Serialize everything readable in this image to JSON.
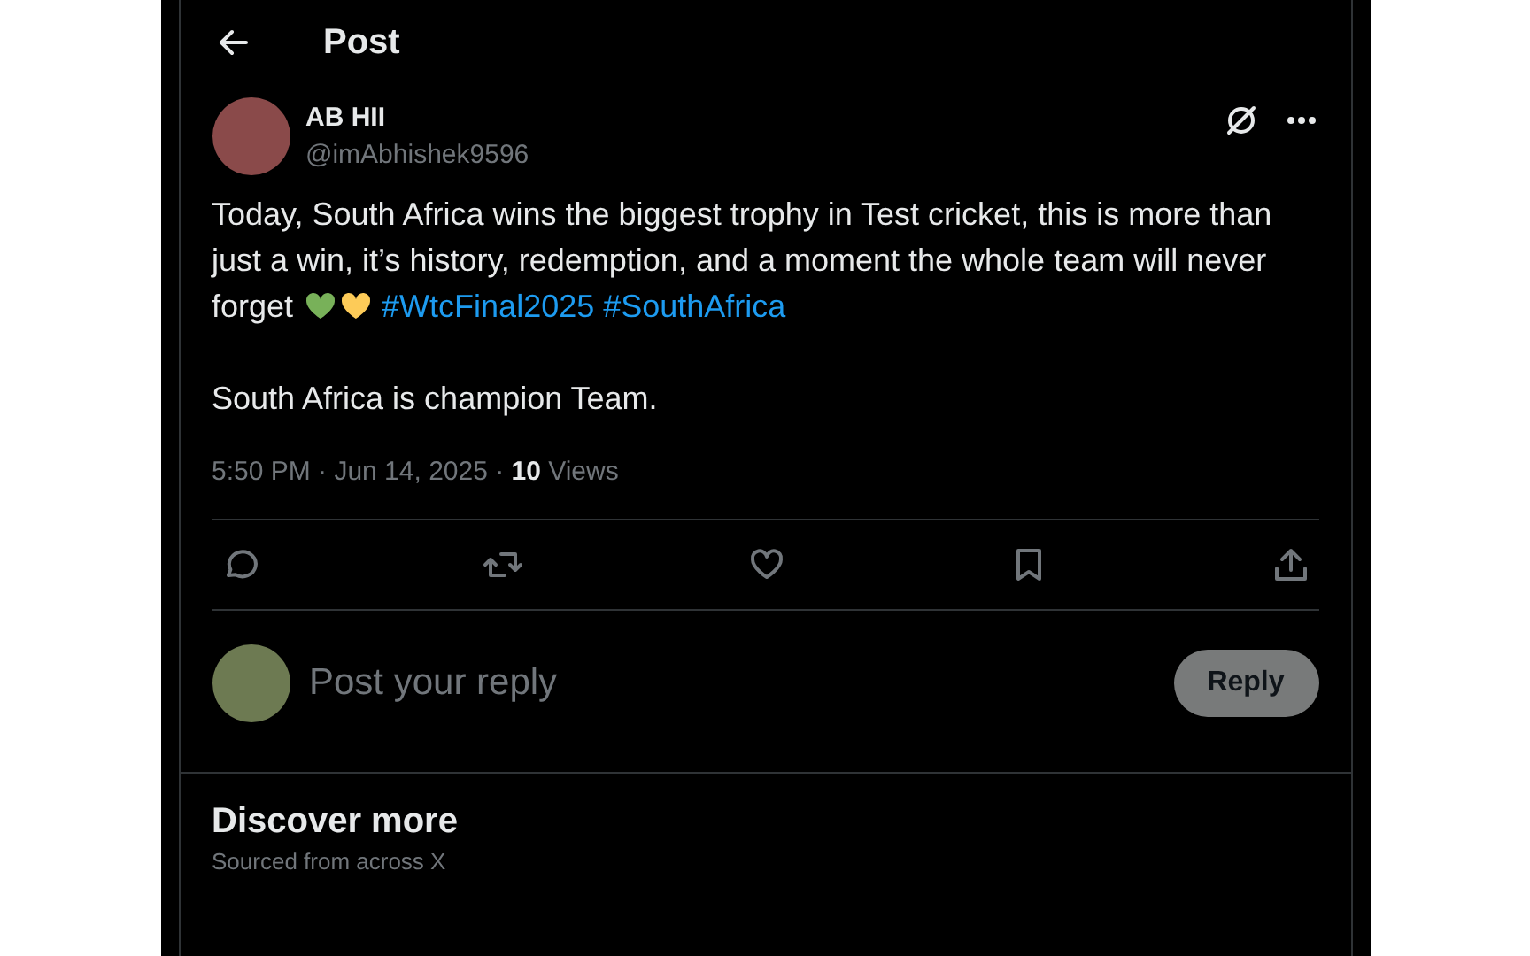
{
  "header": {
    "title": "Post"
  },
  "post": {
    "author": {
      "name": "AB HII",
      "handle": "@imAbhishek9596"
    },
    "text": "Today, South Africa wins the biggest trophy in Test cricket, this is more than just a win, it’s history, redemption, and a moment the whole team will never forget",
    "hashtags": [
      "#WtcFinal2025",
      "#SouthAfrica"
    ],
    "text_2": "South Africa is champion Team.",
    "meta": "5:50 PM · Jun 14, 2025 · **10** Views"
  },
  "reply_box": {
    "placeholder": "Post your reply",
    "button": "Reply"
  },
  "discover": {
    "title": "Discover more",
    "subtitle": "Sourced from across X"
  }
}
